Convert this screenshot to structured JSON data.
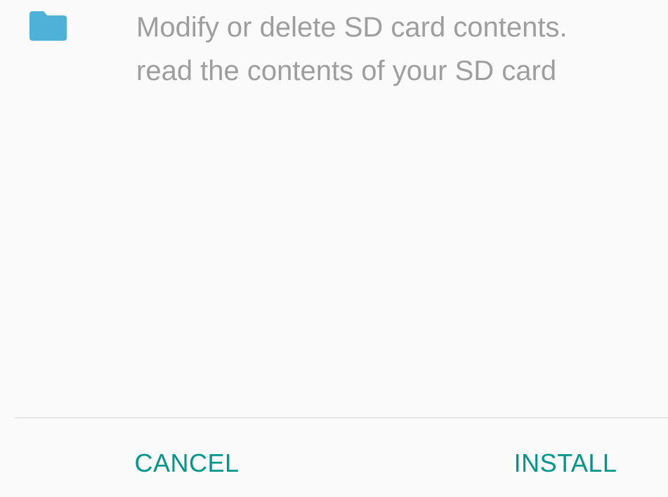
{
  "permission": {
    "icon": "folder-icon",
    "icon_color": "#4fb0d8",
    "lines": [
      "Modify or delete SD card contents.",
      "read the contents of your SD card"
    ]
  },
  "actions": {
    "cancel_label": "CANCEL",
    "install_label": "INSTALL",
    "accent_color": "#00968a"
  }
}
